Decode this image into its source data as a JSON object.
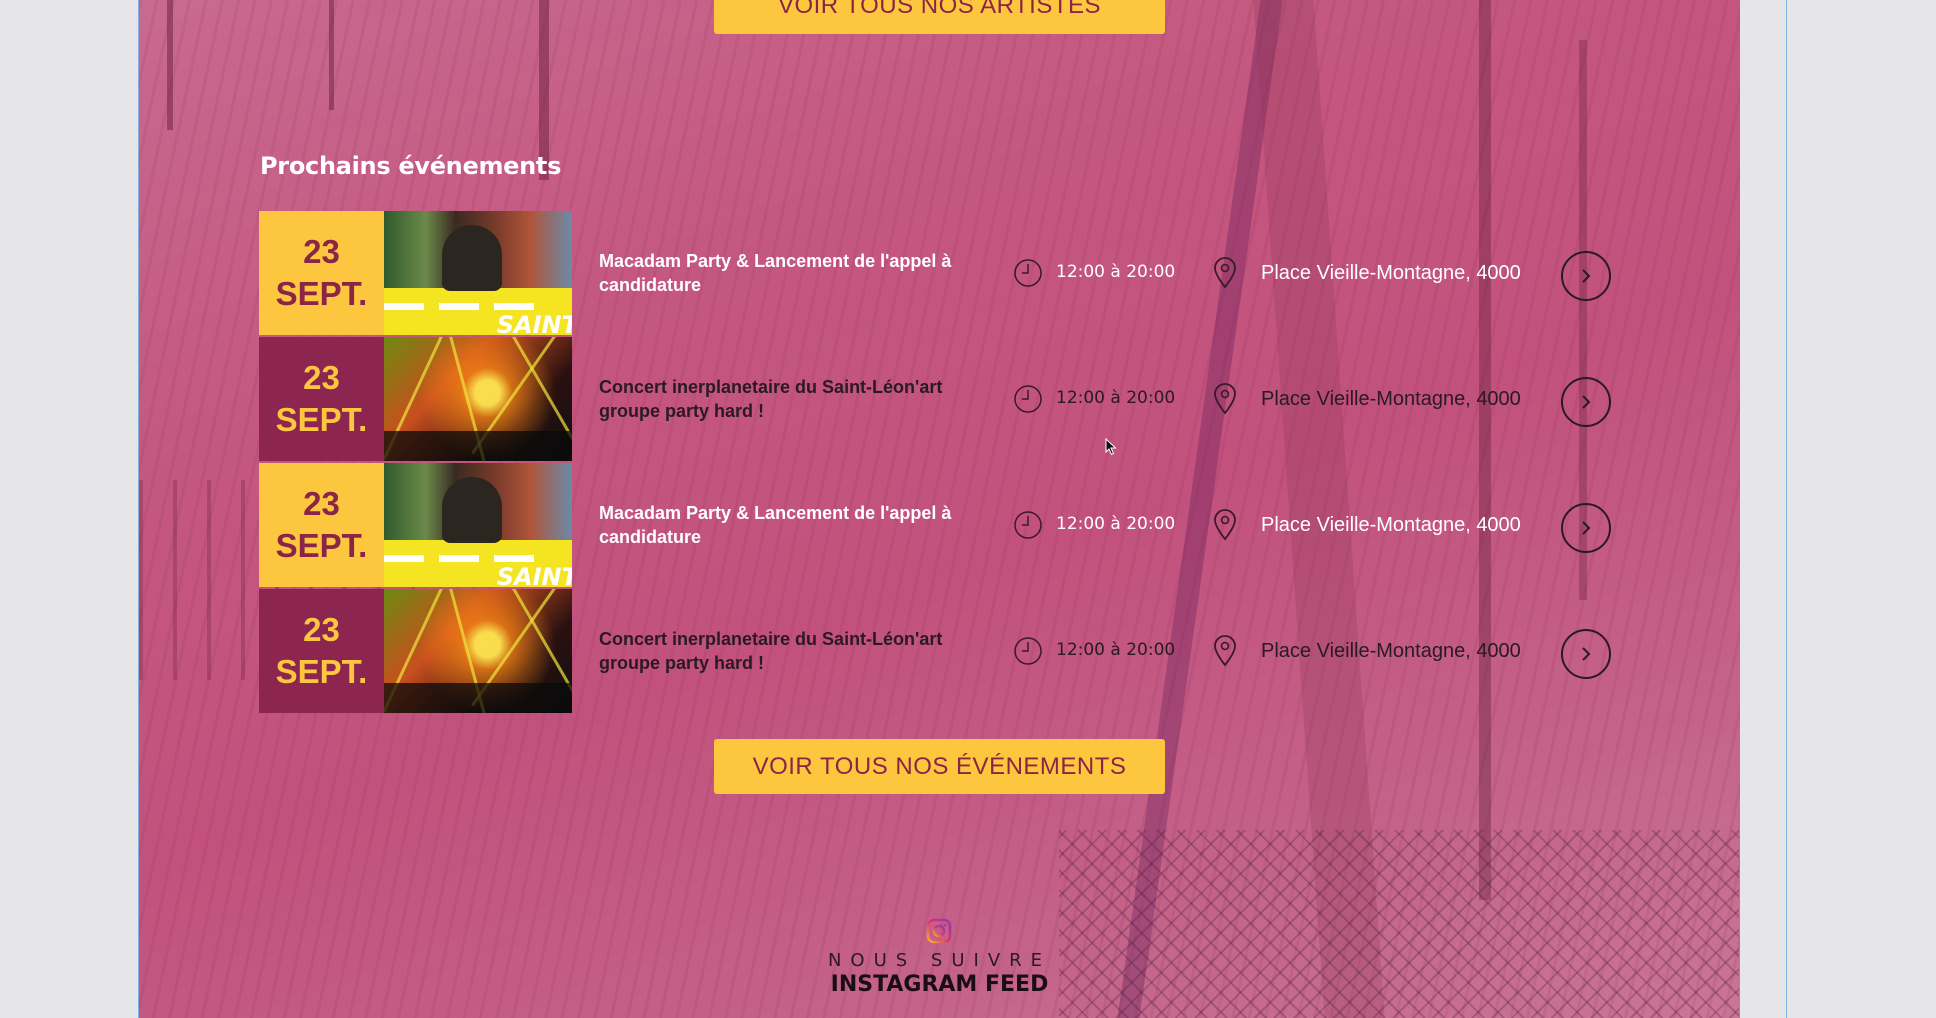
{
  "colors": {
    "accent_yellow": "#fdc63f",
    "accent_plum": "#8c2550",
    "overlay_pink": "#c2527d",
    "text_dark": "#2a1a22"
  },
  "artists_button": {
    "label": "VOIR TOUS NOS ARTISTES"
  },
  "events": {
    "heading": "Prochains événements",
    "items": [
      {
        "day": "23",
        "month": "SEPT.",
        "title": "Macadam Party & Lancement de l'appel à candidature",
        "time": "12:00 à 20:00",
        "place": "Place Vieille-Montagne, 4000",
        "image": "dj-photo",
        "theme": "yellow"
      },
      {
        "day": "23",
        "month": "SEPT.",
        "title": "Concert inerplanetaire du Saint-Léon'art groupe party hard !",
        "time": "12:00 à 20:00",
        "place": "Place Vieille-Montagne, 4000",
        "image": "concert-photo",
        "theme": "plum"
      },
      {
        "day": "23",
        "month": "SEPT.",
        "title": "Macadam Party & Lancement de l'appel à candidature",
        "time": "12:00 à 20:00",
        "place": "Place Vieille-Montagne, 4000",
        "image": "dj-photo",
        "theme": "yellow"
      },
      {
        "day": "23",
        "month": "SEPT.",
        "title": "Concert inerplanetaire du Saint-Léon'art groupe party hard !",
        "time": "12:00 à 20:00",
        "place": "Place Vieille-Montagne, 4000",
        "image": "concert-photo",
        "theme": "plum"
      }
    ],
    "thumb_brand": "SAINT",
    "button_label": "VOIR TOUS NOS ÉVÉNEMENTS"
  },
  "instagram": {
    "icon": "instagram-icon",
    "follow_label": "NOUS SUIVRE",
    "feed_title": "INSTAGRAM FEED"
  },
  "icons": {
    "time": "clock-icon",
    "location": "map-pin-icon",
    "more": "chevron-right-icon"
  }
}
